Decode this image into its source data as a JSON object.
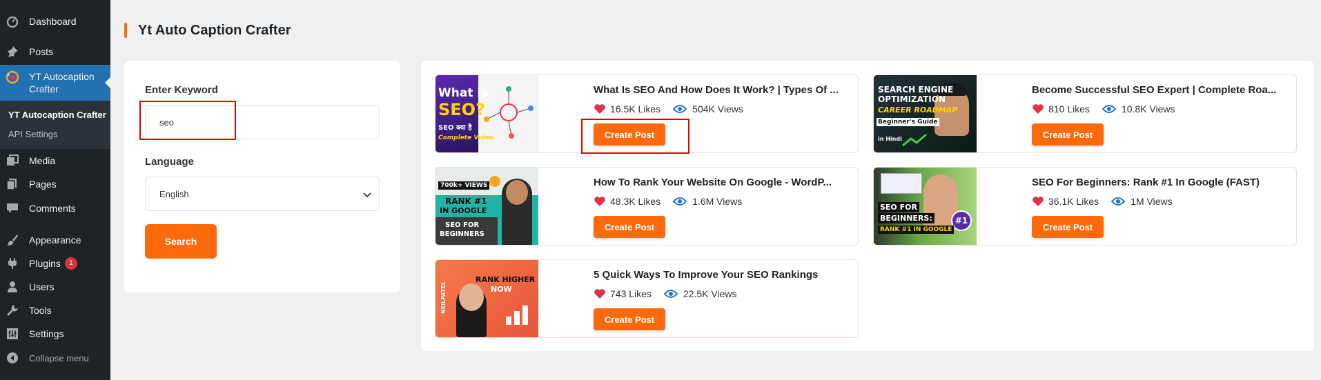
{
  "sidebar": {
    "items": [
      {
        "label": "Dashboard",
        "icon": "dashboard-icon"
      },
      {
        "label": "Posts",
        "icon": "pin-icon"
      },
      {
        "label": "YT Autocaption Crafter",
        "icon": "plugin-logo-icon"
      },
      {
        "label": "Media",
        "icon": "media-icon"
      },
      {
        "label": "Pages",
        "icon": "pages-icon"
      },
      {
        "label": "Comments",
        "icon": "comment-icon"
      },
      {
        "label": "Appearance",
        "icon": "brush-icon"
      },
      {
        "label": "Plugins",
        "icon": "plug-icon",
        "badge": "1"
      },
      {
        "label": "Users",
        "icon": "user-icon"
      },
      {
        "label": "Tools",
        "icon": "wrench-icon"
      },
      {
        "label": "Settings",
        "icon": "settings-icon"
      }
    ],
    "submenu": [
      {
        "label": "YT Autocaption Crafter"
      },
      {
        "label": "API Settings"
      }
    ],
    "collapse_label": "Collapse menu"
  },
  "page": {
    "title": "Yt Auto Caption Crafter"
  },
  "form": {
    "keyword_label": "Enter Keyword",
    "keyword_value": "seo",
    "language_label": "Language",
    "language_value": "English",
    "search_label": "Search"
  },
  "results": [
    {
      "title": "What Is SEO And How Does It Work? | Types Of ...",
      "likes": "16.5K Likes",
      "views": "504K Views",
      "button": "Create Post",
      "thumb_text": [
        "What is",
        "SEO?",
        "SEO क्या है",
        "Complete Video"
      ]
    },
    {
      "title": "Become Successful SEO Expert | Complete Roa...",
      "likes": "810 Likes",
      "views": "10.8K Views",
      "button": "Create Post",
      "thumb_text": [
        "SEARCH ENGINE",
        "OPTIMIZATION",
        "CAREER ROADMAP",
        "Beginner's Guide",
        "in Hindi"
      ]
    },
    {
      "title": "How To Rank Your Website On Google - WordP...",
      "likes": "48.3K Likes",
      "views": "1.6M Views",
      "button": "Create Post",
      "thumb_text": [
        "700k+ VIEWS",
        "RANK #1",
        "IN GOOGLE",
        "SEO FOR",
        "BEGINNERS"
      ]
    },
    {
      "title": "SEO For Beginners: Rank #1 In Google (FAST)",
      "likes": "36.1K Likes",
      "views": "1M Views",
      "button": "Create Post",
      "thumb_text": [
        "SEO FOR",
        "BEGINNERS:",
        "RANK #1 IN GOOGLE",
        "#1"
      ]
    },
    {
      "title": "5 Quick Ways To Improve Your SEO Rankings",
      "likes": "743 Likes",
      "views": "22.5K Views",
      "button": "Create Post",
      "thumb_text": [
        "RANK HIGHER",
        "NOW",
        "NEILPATEL"
      ]
    }
  ],
  "colors": {
    "accent": "#fd6a0e",
    "sidebar_bg": "#1d2327",
    "sidebar_active": "#2271b1",
    "highlight": "#e00000",
    "heart": "#e0304b",
    "eye": "#2271d1"
  }
}
